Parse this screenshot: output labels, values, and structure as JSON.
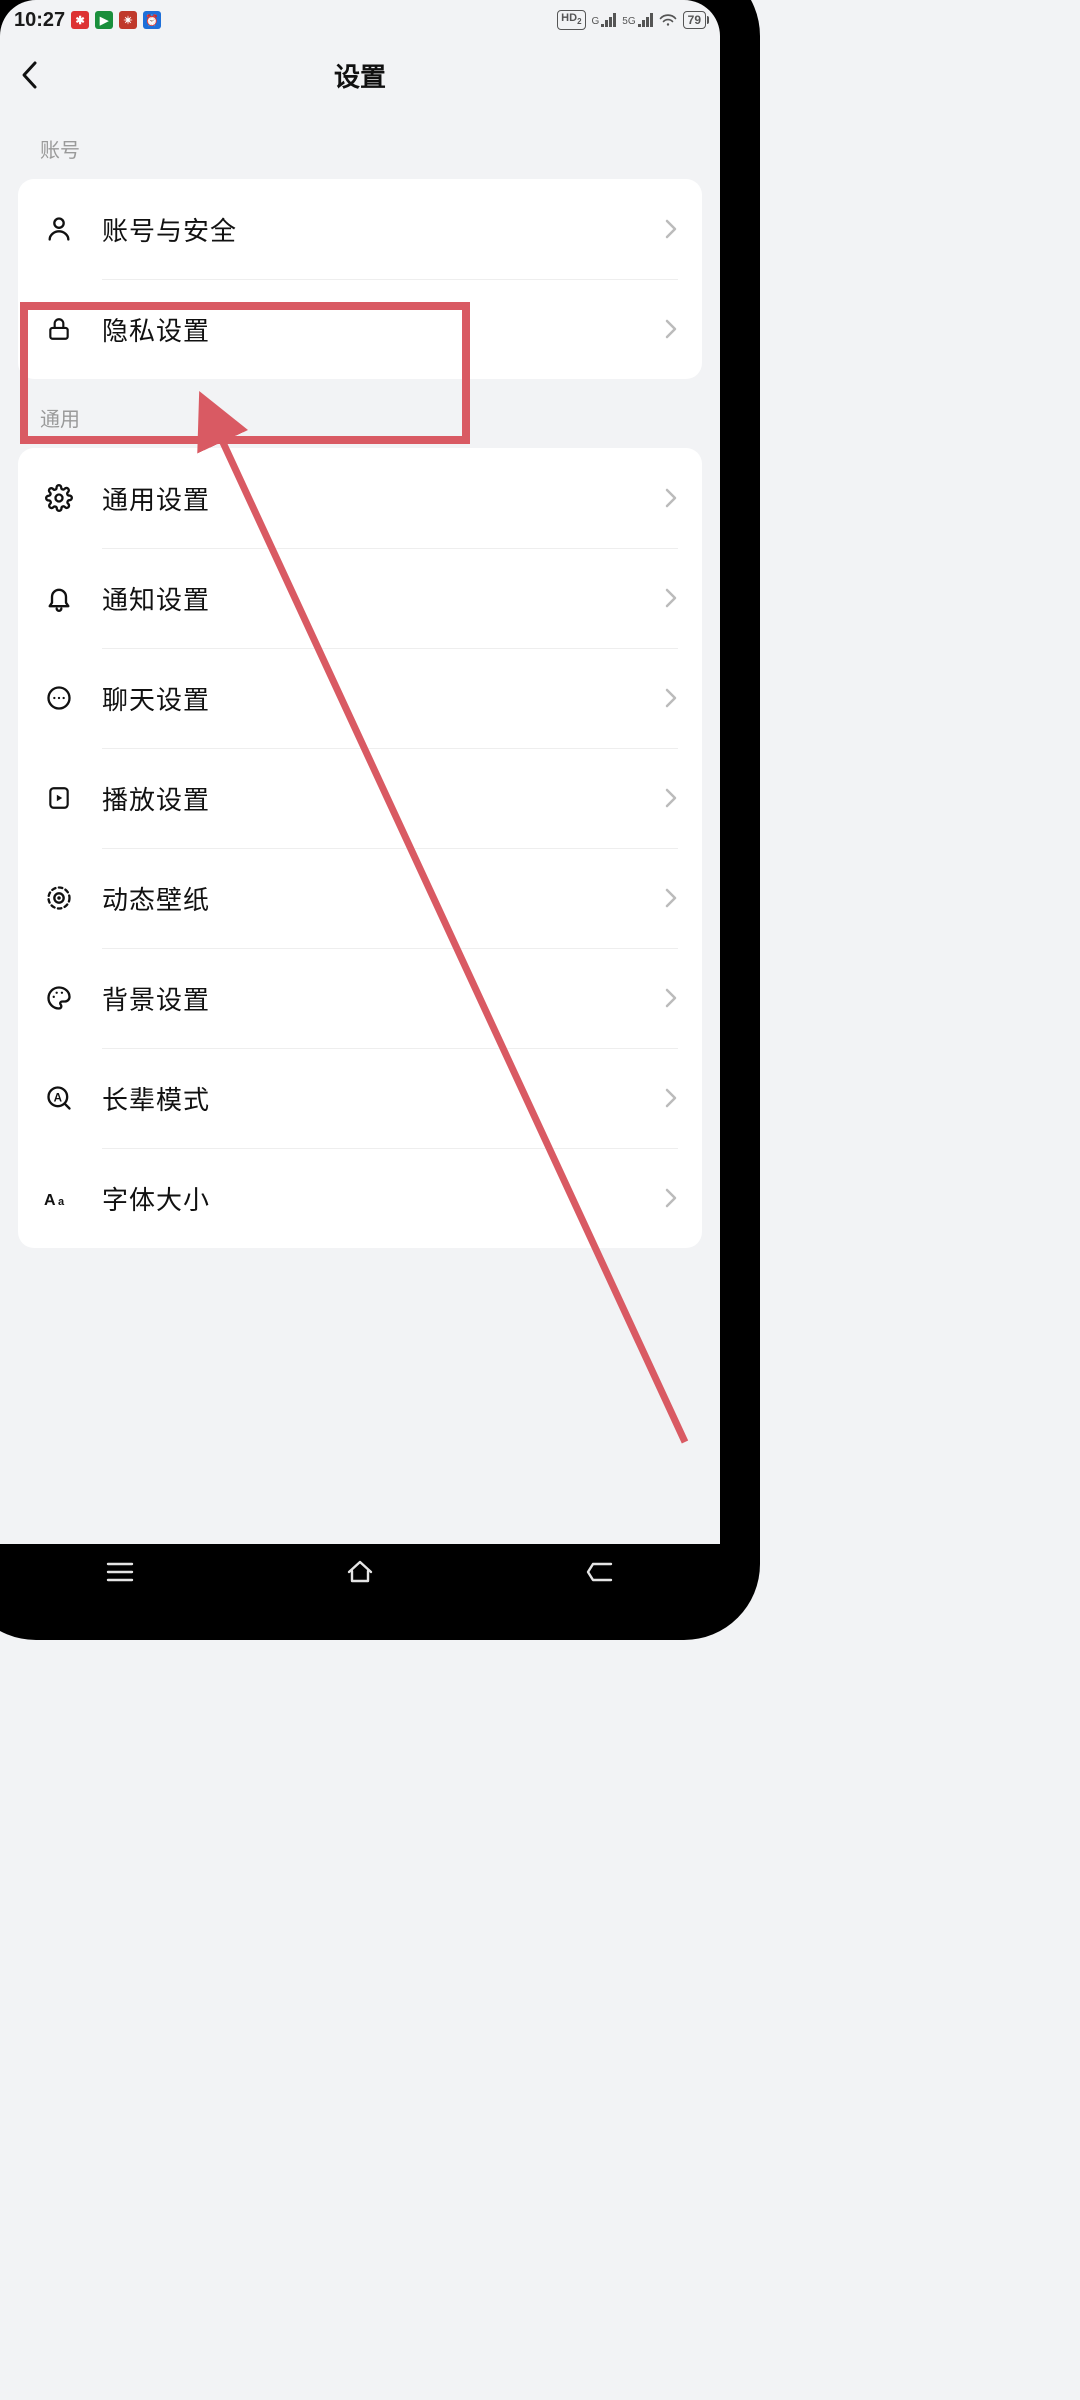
{
  "status": {
    "time": "10:27",
    "hd_label": "HD",
    "hd_sub": "2",
    "net1_label": "G",
    "net2_label": "5G",
    "battery": "79"
  },
  "header": {
    "title": "设置"
  },
  "sections": [
    {
      "header": "账号",
      "items": [
        {
          "label": "账号与安全"
        },
        {
          "label": "隐私设置"
        }
      ]
    },
    {
      "header": "通用",
      "items": [
        {
          "label": "通用设置"
        },
        {
          "label": "通知设置"
        },
        {
          "label": "聊天设置"
        },
        {
          "label": "播放设置"
        },
        {
          "label": "动态壁纸"
        },
        {
          "label": "背景设置"
        },
        {
          "label": "长辈模式"
        },
        {
          "label": "字体大小"
        }
      ]
    }
  ],
  "annotation": {
    "highlight_color": "#d95a63"
  }
}
